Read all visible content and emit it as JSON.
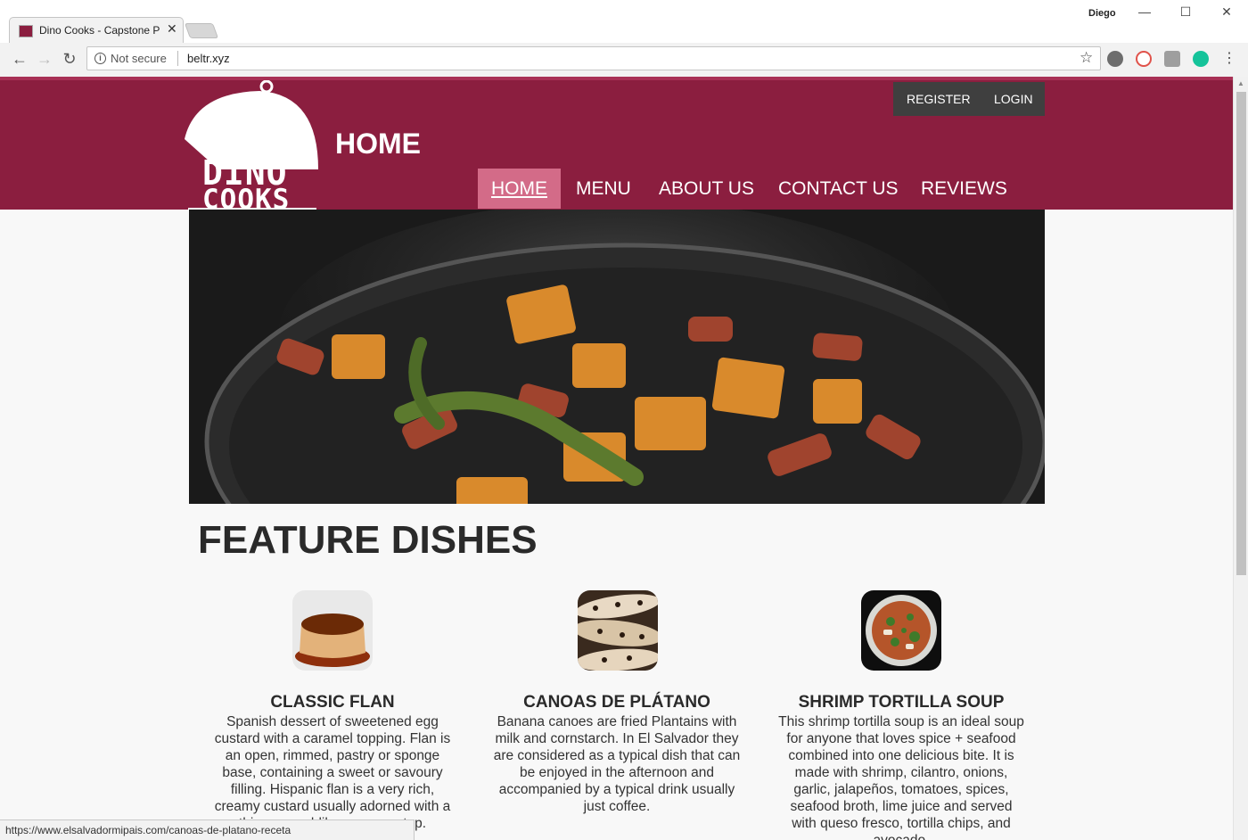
{
  "browser": {
    "tab_title": "Dino Cooks - Capstone P",
    "profile_name": "Diego",
    "security_label": "Not secure",
    "url": "beltr.xyz",
    "status_url": "https://www.elsalvadormipais.com/canoas-de-platano-receta"
  },
  "site": {
    "logo_line1": "DINO",
    "logo_line2": "COOKS",
    "page_heading": "HOME",
    "auth": {
      "register": "REGISTER",
      "login": "LOGIN"
    },
    "nav": [
      "HOME",
      "MENU",
      "ABOUT US",
      "CONTACT US",
      "REVIEWS"
    ],
    "active_nav": "HOME",
    "section_title": "FEATURE DISHES",
    "dishes": [
      {
        "name": "CLASSIC FLAN",
        "description": "Spanish dessert of sweetened egg custard with a caramel topping. Flan is an open, rimmed, pastry or sponge base, containing a sweet or savoury filling. Hispanic flan is a very rich, creamy custard usually adorned with a thin caramel-like sauce on top."
      },
      {
        "name": "CANOAS DE PLÁTANO",
        "description": "Banana canoes are fried Plantains with milk and cornstarch. In El Salvador they are considered as a typical dish that can be enjoyed in the afternoon and accompanied by a typical drink usually just coffee."
      },
      {
        "name": "SHRIMP TORTILLA SOUP",
        "description": "This shrimp tortilla soup is an ideal soup for anyone that loves spice + seafood combined into one delicious bite. It is made with shrimp, cilantro, onions, garlic, jalapeños, tomatoes, spices, seafood broth, lime juice and served with queso fresco, tortilla chips, and avocado."
      }
    ]
  },
  "colors": {
    "header": "#8b1e3f",
    "active_nav": "#d36b88",
    "auth_bar": "#3f3f3f"
  }
}
